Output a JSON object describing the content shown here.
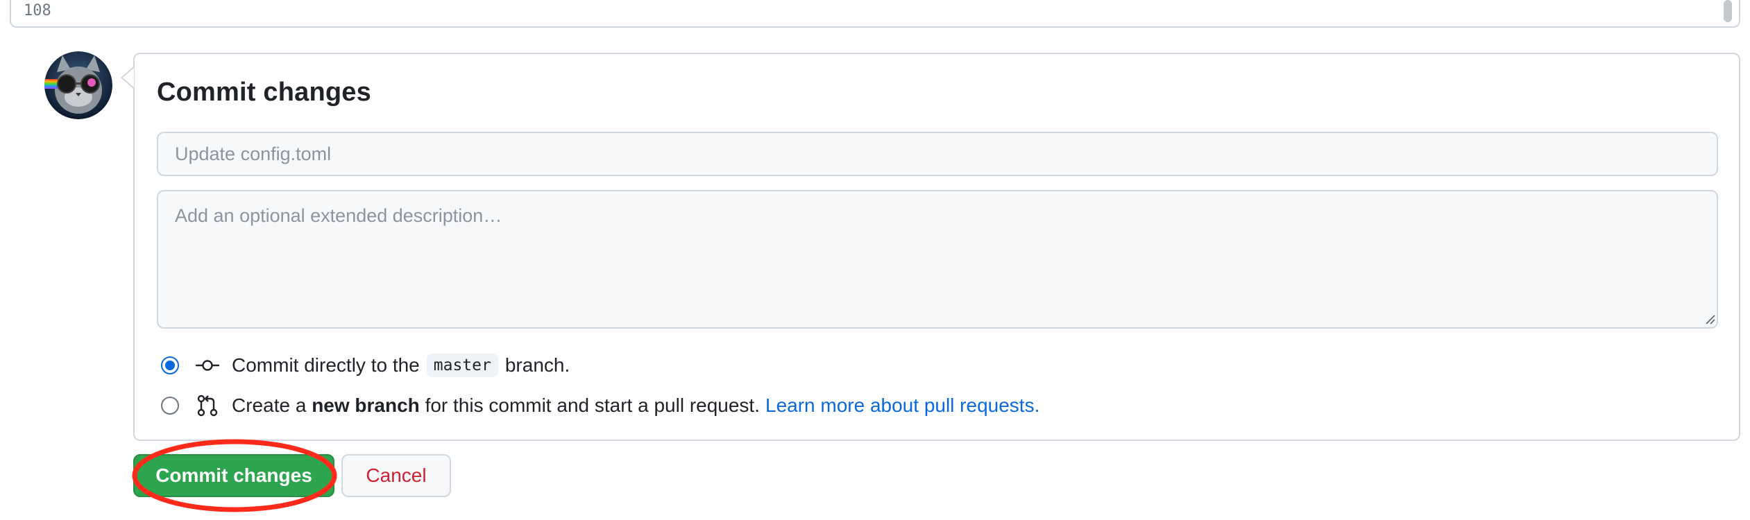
{
  "editor": {
    "line_number": "108"
  },
  "avatar": {
    "alt": "User avatar"
  },
  "commit_form": {
    "title": "Commit changes",
    "summary_placeholder": "Update config.toml",
    "summary_value": "",
    "description_placeholder": "Add an optional extended description…",
    "description_value": "",
    "option_direct": {
      "prefix": "Commit directly to the",
      "branch": "master",
      "suffix": "branch.",
      "selected": true,
      "icon": "git-commit-icon"
    },
    "option_new_branch": {
      "prefix": "Create a",
      "bold": "new branch",
      "suffix": "for this commit and start a pull request.",
      "link": "Learn more about pull requests.",
      "selected": false,
      "icon": "git-pull-request-icon"
    }
  },
  "buttons": {
    "commit_label": "Commit changes",
    "cancel_label": "Cancel"
  },
  "colors": {
    "primary_green": "#2da44e",
    "danger_red": "#cf222e",
    "link_blue": "#0969da",
    "annotation_red": "#ff2a1a"
  }
}
